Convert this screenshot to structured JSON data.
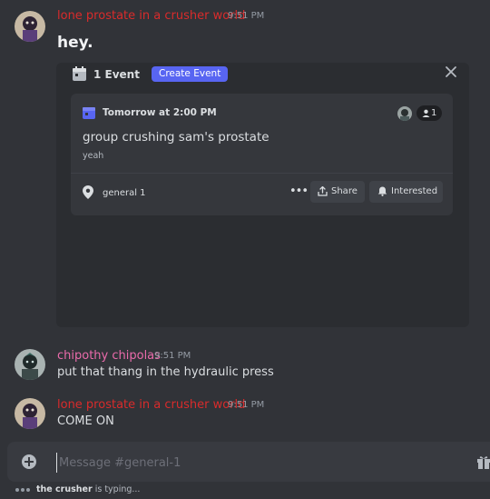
{
  "messages": [
    {
      "username": "lone prostate in a crusher world",
      "username_color": "#d92b2b",
      "time": "9:51 PM",
      "text": "hey."
    },
    {
      "username": "chipothy chipolas",
      "username_color": "#eb6bab",
      "time": "9:51 PM",
      "text": "put that thang in the hydraulic press"
    },
    {
      "username": "lone prostate in a crusher world",
      "username_color": "#d92b2b",
      "time": "9:51 PM",
      "text": "COME ON"
    }
  ],
  "events_panel": {
    "count_label": "1 Event",
    "create_label": "Create Event",
    "close_icon": "close-icon",
    "event": {
      "when": "Tomorrow at 2:00 PM",
      "title": "group crushing sam's prostate",
      "description": "yeah",
      "rsvp_count": "1",
      "location": "general 1",
      "share_label": "Share",
      "interested_label": "Interested",
      "more_label": "•••"
    }
  },
  "composer": {
    "placeholder": "Message #general-1",
    "plus_icon": "plus-circle-icon",
    "gift_icon": "gift-icon"
  },
  "typing": {
    "user": "the crusher",
    "suffix": " is typing..."
  },
  "colors": {
    "background": "#313338",
    "accent": "#5865f2",
    "panel": "#2b2d31",
    "card": "#35373c"
  }
}
